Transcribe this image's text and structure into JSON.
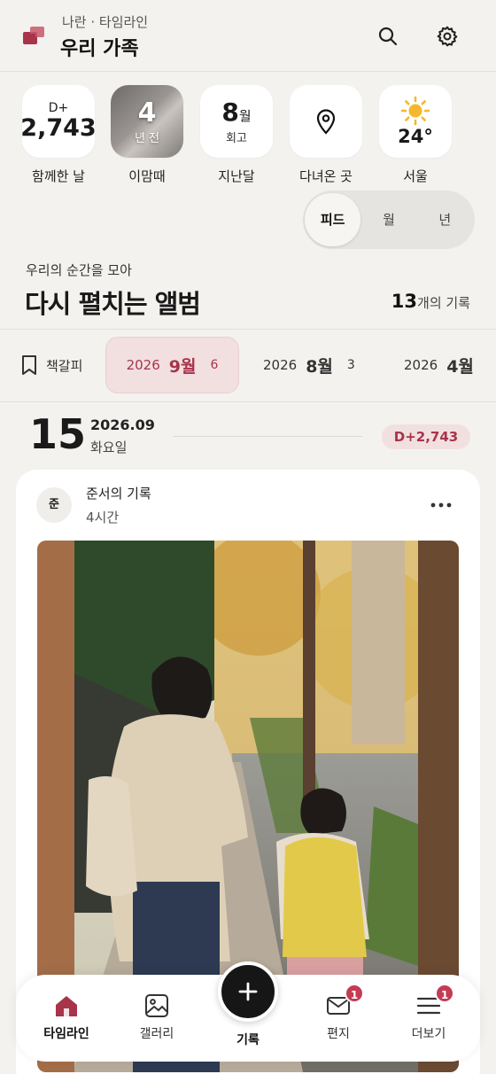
{
  "header": {
    "subtitle": "나란 · 타임라인",
    "title": "우리 가족",
    "icons": [
      "search-icon",
      "gear-icon"
    ]
  },
  "stats": [
    {
      "top": "D+",
      "main": "2,743",
      "label": "함께한 날"
    },
    {
      "main": "4",
      "sub": "년 전",
      "label": "이맘때"
    },
    {
      "main": "8",
      "unit": "월",
      "sub": "회고",
      "label": "지난달"
    },
    {
      "icon": "map-pin-icon",
      "label": "다녀온 곳"
    },
    {
      "icon": "sun-icon",
      "main": "24°",
      "label": "서울"
    }
  ],
  "view_toggle": {
    "options": [
      "피드",
      "월",
      "년"
    ],
    "selected": "피드"
  },
  "album": {
    "eyebrow": "우리의 순간을 모아",
    "title": "다시 펼치는 앨범",
    "count": "13",
    "count_suffix": "개의 기록"
  },
  "date_filter": {
    "bookmark_label": "책갈피",
    "items": [
      {
        "year": "2026",
        "month": "9월",
        "count": "6",
        "active": true
      },
      {
        "year": "2026",
        "month": "8월",
        "count": "3"
      },
      {
        "year": "2026",
        "month": "4월"
      }
    ]
  },
  "day_header": {
    "day": "15",
    "year_month": "2026.09",
    "weekday": "화요일",
    "dday": "D+2,743"
  },
  "post": {
    "avatar": "준",
    "author": "준서의 기록",
    "time": "4시간"
  },
  "nav": {
    "items": [
      {
        "label": "타임라인",
        "active": true
      },
      {
        "label": "갤러리"
      },
      {
        "label": "기록"
      },
      {
        "label": "편지",
        "badge": "1"
      },
      {
        "label": "더보기",
        "badge": "1"
      }
    ]
  },
  "colors": {
    "accent": "#a8344a",
    "accent_bg": "#f2dfe0",
    "background": "#f3f2ef"
  }
}
